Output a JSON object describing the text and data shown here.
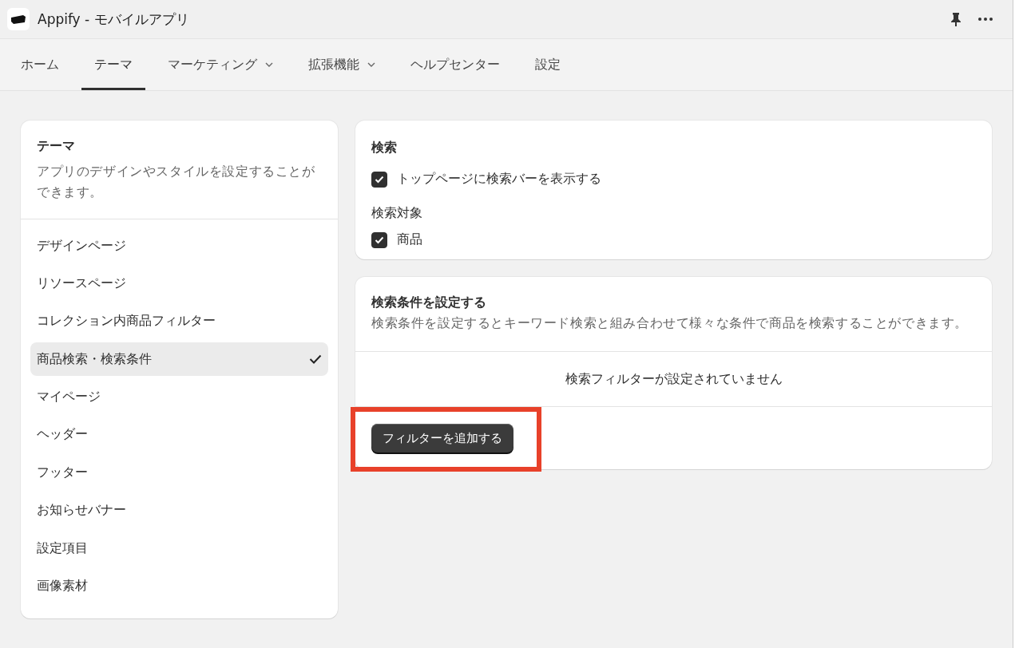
{
  "window": {
    "title": "Appify - モバイルアプリ"
  },
  "nav": {
    "tabs": [
      {
        "label": "ホーム",
        "selected": false,
        "dropdown": false
      },
      {
        "label": "テーマ",
        "selected": true,
        "dropdown": false
      },
      {
        "label": "マーケティング",
        "selected": false,
        "dropdown": true
      },
      {
        "label": "拡張機能",
        "selected": false,
        "dropdown": true
      },
      {
        "label": "ヘルプセンター",
        "selected": false,
        "dropdown": false
      },
      {
        "label": "設定",
        "selected": false,
        "dropdown": false
      }
    ]
  },
  "sidebar": {
    "title": "テーマ",
    "description": "アプリのデザインやスタイルを設定することができます。",
    "items": [
      {
        "label": "デザインページ",
        "selected": false
      },
      {
        "label": "リソースページ",
        "selected": false
      },
      {
        "label": "コレクション内商品フィルター",
        "selected": false
      },
      {
        "label": "商品検索・検索条件",
        "selected": true
      },
      {
        "label": "マイページ",
        "selected": false
      },
      {
        "label": "ヘッダー",
        "selected": false
      },
      {
        "label": "フッター",
        "selected": false
      },
      {
        "label": "お知らせバナー",
        "selected": false
      },
      {
        "label": "設定項目",
        "selected": false
      },
      {
        "label": "画像素材",
        "selected": false
      }
    ]
  },
  "search_card": {
    "title": "検索",
    "show_search_bar": {
      "label": "トップページに検索バーを表示する",
      "checked": true
    },
    "target_label": "検索対象",
    "targets": [
      {
        "label": "商品",
        "checked": true
      }
    ]
  },
  "conditions_card": {
    "title": "検索条件を設定する",
    "description": "検索条件を設定するとキーワード検索と組み合わせて様々な条件で商品を検索することができます。",
    "empty_message": "検索フィルターが設定されていません",
    "add_button": "フィルターを追加する",
    "highlighted": true
  }
}
